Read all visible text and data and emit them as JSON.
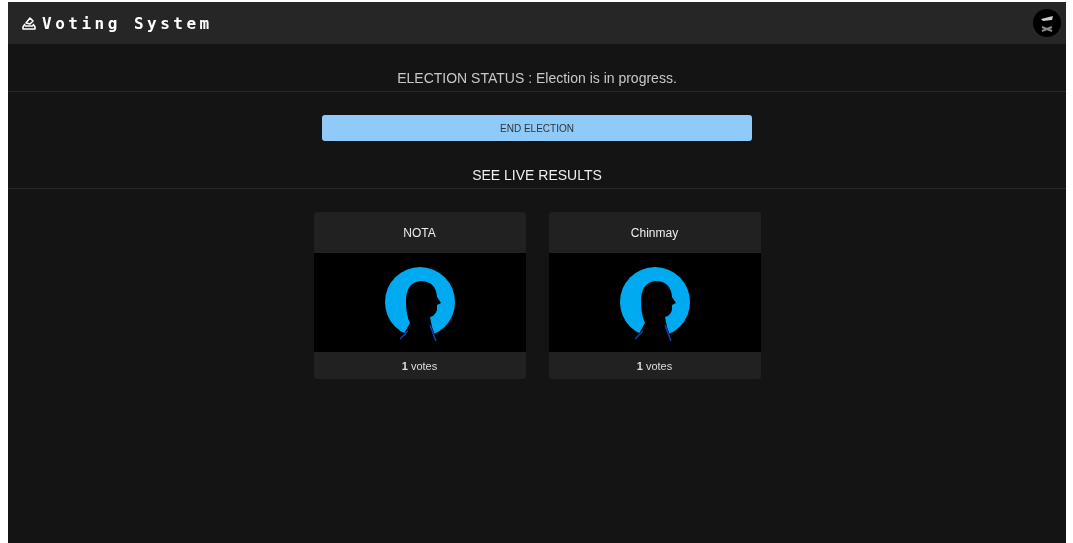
{
  "header": {
    "title": "Voting System"
  },
  "status": "ELECTION STATUS : Election is in progress.",
  "end_button": "END ELECTION",
  "results_heading": "SEE LIVE RESULTS",
  "candidates": [
    {
      "name": "NOTA",
      "votes": "**1** votes"
    },
    {
      "name": "Chinmay",
      "votes": "**1** votes"
    }
  ]
}
